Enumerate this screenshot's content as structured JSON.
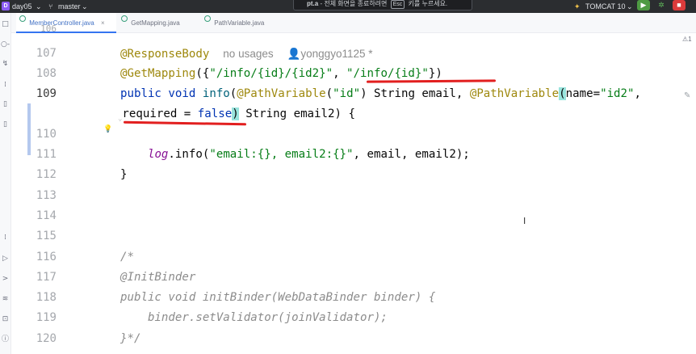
{
  "titlebar": {
    "project_badge": "D",
    "project": "day05",
    "branch": "master",
    "notice_prefix": "pt.a",
    "notice_text": "- 전체 화면을 종료하려면",
    "notice_key": "Esc",
    "notice_suffix": "키를 누르세요.",
    "run_config": "TOMCAT 10",
    "chevron": "⌄",
    "run_icon": "▶",
    "debug_icon": "✲",
    "stop_icon": "■"
  },
  "tabs": [
    {
      "label": "MemberController.java",
      "close": "×",
      "active": true
    },
    {
      "label": "GetMapping.java",
      "close": "",
      "active": false
    },
    {
      "label": "PathVariable.java",
      "close": "",
      "active": false
    }
  ],
  "toolstrip": [
    "□",
    "○-",
    "↯",
    "⁞",
    "▯",
    "▯",
    "⁞",
    "▷",
    ">",
    "≋",
    "⊡",
    "ⓘ"
  ],
  "gutter": {
    "line_numbers": [
      "106",
      "107",
      "108",
      "109",
      "",
      "110",
      "111",
      "112",
      "113",
      "114",
      "115",
      "116",
      "117",
      "118",
      "119",
      "120"
    ],
    "bulb": "💡"
  },
  "code": {
    "l107_ann": "@ResponseBody",
    "l107_hint_usages": "no usages",
    "l107_hint_author": "yonggyo1125 *",
    "l108_ann": "@GetMapping",
    "l108_open": "({",
    "l108_str1": "\"/info/{id}/{id2}\"",
    "l108_comma": ", ",
    "l108_str2": "\"/info/{id}\"",
    "l108_close": "})",
    "l109_public": "public",
    "l109_void": " void ",
    "l109_info": "info",
    "l109_paren": "(",
    "l109_ann1": "@PathVariable",
    "l109_p1": "(",
    "l109_id": "\"id\"",
    "l109_rest1": ") String email, ",
    "l109_ann2": "@PathVariable",
    "l109_p2": "(",
    "l109_name": "name=",
    "l109_id2": "\"id2\"",
    "l109_comma": ",",
    "l109b_mark": "⌄",
    "l109b_req": "required = ",
    "l109b_false": "false",
    "l109b_close": ")",
    "l109b_rest": " String email2) {",
    "l111_indent": "    ",
    "l111_log": "log",
    "l111_dot": ".info(",
    "l111_str": "\"email:{}, email2:{}\"",
    "l111_rest": ", email, email2);",
    "l112": "}",
    "l116": "/*",
    "l117": "@InitBinder",
    "l118": "public void initBinder(WebDataBinder binder) {",
    "l119": "    binder.setValidator(joinValidator);",
    "l120": "}*/"
  },
  "right_edge_text": "⚠1 ",
  "edit_hint": "✎",
  "ibeam": "I",
  "colors": {
    "underline": "#e21f1f",
    "annotation": "#9e880d",
    "string": "#067d17",
    "keyword": "#0033b3"
  }
}
